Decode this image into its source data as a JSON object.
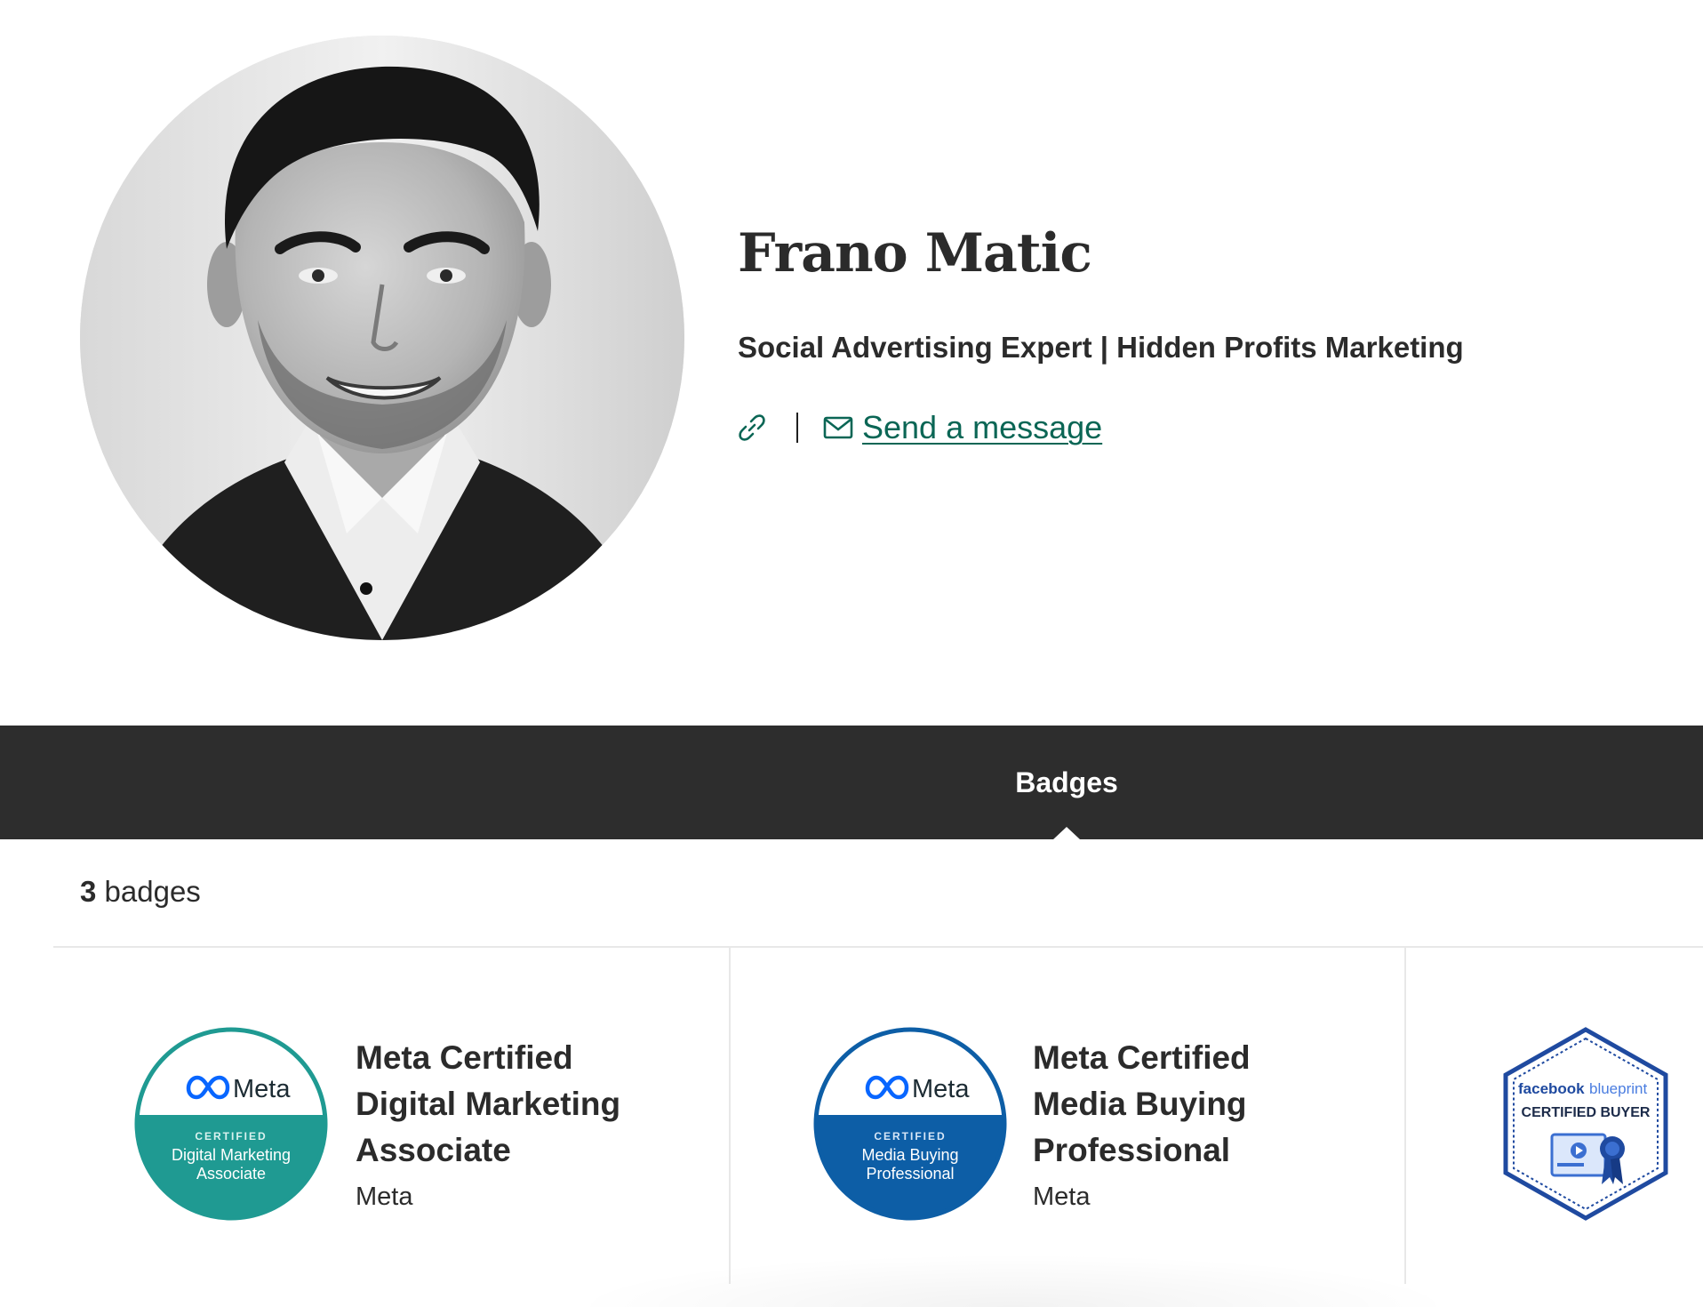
{
  "profile": {
    "name": "Frano Matic",
    "headline": "Social Advertising Expert | Hidden Profits Marketing",
    "link_icon": "link-icon",
    "message_icon": "envelope-icon",
    "message_label": "Send a message",
    "link_color": "#0b6655"
  },
  "tabs": {
    "items": [
      {
        "label": "Badges",
        "active": true
      }
    ],
    "background": "#2d2d2d"
  },
  "badges": {
    "count": "3",
    "count_suffix": " badges",
    "items": [
      {
        "title": "Meta Certified Digital Marketing Associate",
        "issuer": "Meta",
        "emblem": {
          "brand": "Meta",
          "kicker": "CERTIFIED",
          "line1": "Digital Marketing",
          "line2": "Associate",
          "color": "#1f9a92"
        }
      },
      {
        "title": "Meta Certified Media Buying Professional",
        "issuer": "Meta",
        "emblem": {
          "brand": "Meta",
          "kicker": "CERTIFIED",
          "line1": "Media Buying",
          "line2": "Professional",
          "color": "#0d5ea6"
        }
      },
      {
        "title": "",
        "issuer": "",
        "emblem": {
          "brand_a": "facebook",
          "brand_b": "blueprint",
          "label": "CERTIFIED BUYER",
          "color": "#1f4aa0"
        }
      }
    ]
  }
}
